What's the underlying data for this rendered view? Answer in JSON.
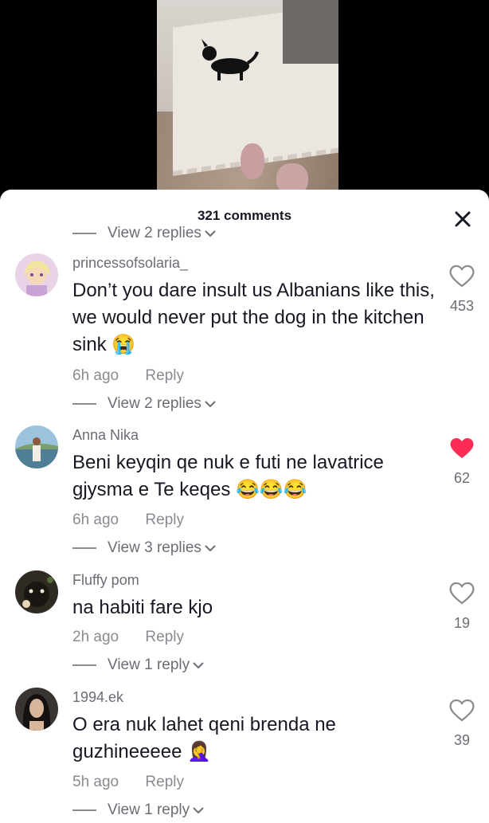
{
  "sheet": {
    "title": "321 comments"
  },
  "top_replies": "View 2 replies",
  "comments": [
    {
      "username": "princessofsolaria_",
      "text": "Don’t you dare insult us Albanians like this, we would never put the dog in the kitchen sink",
      "emoji": "😭",
      "time": "6h ago",
      "reply_label": "Reply",
      "likes": "453",
      "liked": false,
      "view_replies": "View 2 replies"
    },
    {
      "username": "Anna Nika",
      "text": "Beni keyqin qe nuk e futi ne lavatrice gjysma e Te keqes",
      "emoji": "😂😂😂",
      "time": "6h ago",
      "reply_label": "Reply",
      "likes": "62",
      "liked": true,
      "view_replies": "View 3 replies"
    },
    {
      "username": "Fluffy pom",
      "text": "na habiti fare kjo",
      "emoji": "",
      "time": "2h ago",
      "reply_label": "Reply",
      "likes": "19",
      "liked": false,
      "view_replies": "View 1 reply"
    },
    {
      "username": "1994.ek",
      "text": "O era nuk lahet qeni brenda ne guzhineeeee",
      "emoji": "🤦‍♀️",
      "time": "5h ago",
      "reply_label": "Reply",
      "likes": "39",
      "liked": false,
      "view_replies": "View 1 reply"
    }
  ],
  "colors": {
    "liked": "#fe2c55",
    "secondary_text": "#6b6d75"
  },
  "icons": {
    "close": "close-icon",
    "like": "heart-icon",
    "expand": "chevron-down-icon"
  }
}
